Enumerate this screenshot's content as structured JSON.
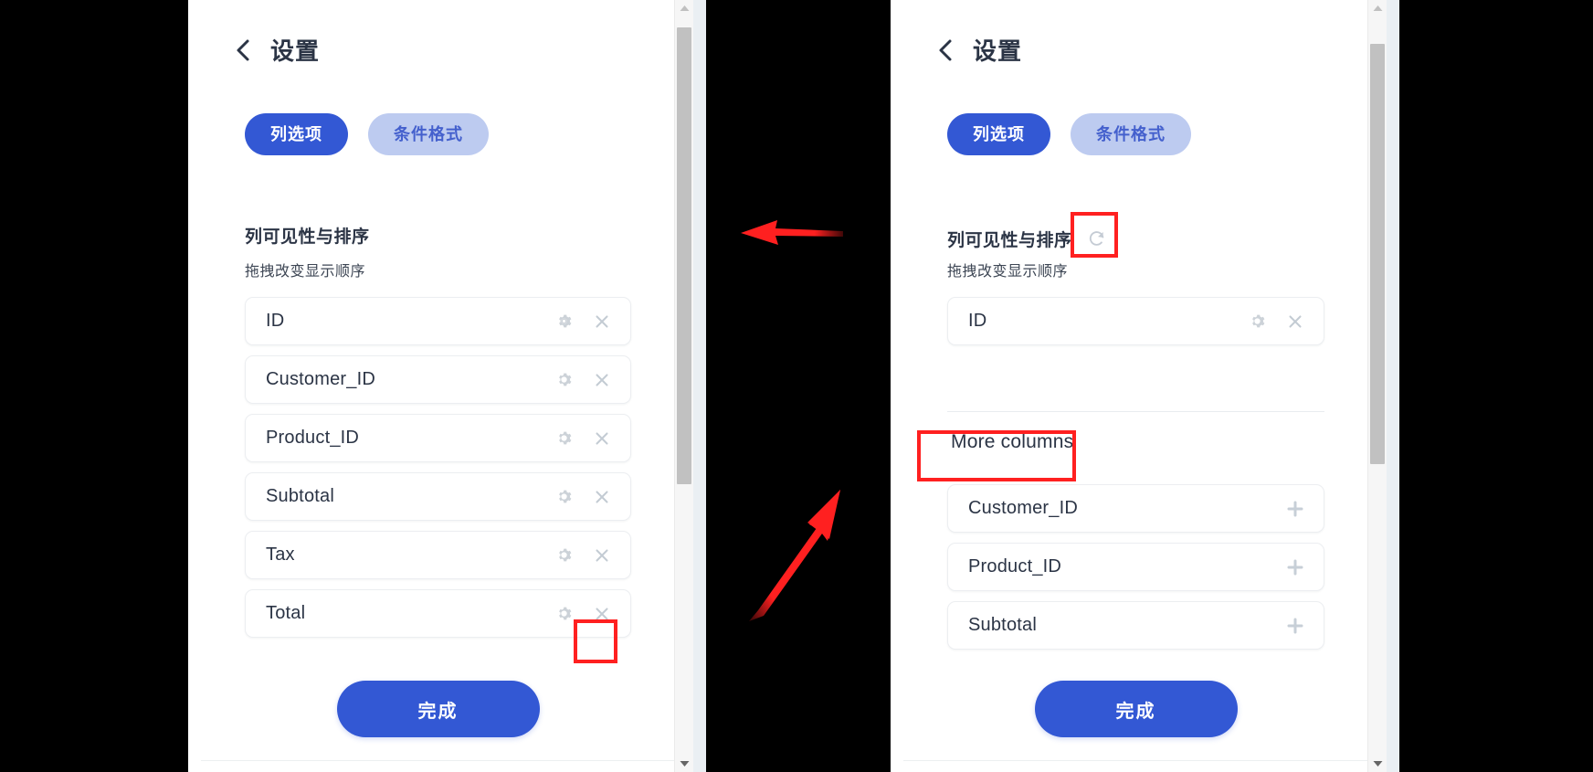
{
  "colors": {
    "accent": "#3358d4",
    "tab_idle_bg": "#bdcbf0",
    "tab_idle_text": "#4460cd",
    "annotation_red": "#ff2020",
    "row_border": "#eceef1",
    "icon_gray": "#c7cfd7",
    "panel_bg": "#ffffff",
    "backdrop": "#000000",
    "page_edge": "#eaeff3"
  },
  "left_panel": {
    "header": {
      "back_icon": "chevron-left-icon",
      "title": "设置"
    },
    "tabs": [
      {
        "label": "列选项",
        "active": true
      },
      {
        "label": "条件格式",
        "active": false
      }
    ],
    "section": {
      "title": "列可见性与排序",
      "subtitle": "拖拽改变显示顺序",
      "has_refresh": false
    },
    "columns": [
      {
        "label": "ID",
        "gear_icon": "gear-icon",
        "remove_icon": "close-icon",
        "highlighted": false
      },
      {
        "label": "Customer_ID",
        "gear_icon": "gear-icon",
        "remove_icon": "close-icon",
        "highlighted": false
      },
      {
        "label": "Product_ID",
        "gear_icon": "gear-icon",
        "remove_icon": "close-icon",
        "highlighted": false
      },
      {
        "label": "Subtotal",
        "gear_icon": "gear-icon",
        "remove_icon": "close-icon",
        "highlighted": false
      },
      {
        "label": "Tax",
        "gear_icon": "gear-icon",
        "remove_icon": "close-icon",
        "highlighted": false
      },
      {
        "label": "Total",
        "gear_icon": "gear-icon",
        "remove_icon": "close-icon",
        "highlighted": true
      }
    ],
    "done_button": "完成",
    "scrollbar": {
      "up_icon": "scroll-up-arrow-icon",
      "down_icon": "scroll-down-arrow-icon",
      "thumb_top_pct": 4,
      "thumb_height_pct": 63
    }
  },
  "right_panel": {
    "header": {
      "back_icon": "chevron-left-icon",
      "title": "设置"
    },
    "tabs": [
      {
        "label": "列选项",
        "active": true
      },
      {
        "label": "条件格式",
        "active": false
      }
    ],
    "section": {
      "title": "列可见性与排序",
      "subtitle": "拖拽改变显示顺序",
      "has_refresh": true,
      "refresh_icon": "refresh-icon"
    },
    "columns": [
      {
        "label": "ID",
        "gear_icon": "gear-icon",
        "remove_icon": "close-icon"
      }
    ],
    "more_columns": {
      "title": "More columns",
      "items": [
        {
          "label": "Customer_ID",
          "add_icon": "plus-icon"
        },
        {
          "label": "Product_ID",
          "add_icon": "plus-icon"
        },
        {
          "label": "Subtotal",
          "add_icon": "plus-icon"
        }
      ]
    },
    "done_button": "完成",
    "scrollbar": {
      "up_icon": "scroll-up-arrow-icon",
      "down_icon": "scroll-down-arrow-icon",
      "thumb_top_pct": 6,
      "thumb_height_pct": 58
    }
  },
  "annotations": {
    "arrow_left": {
      "direction": "left",
      "color": "#ff2020"
    },
    "arrow_up_right": {
      "direction": "up-right",
      "color": "#ff2020"
    },
    "boxes": [
      {
        "target": "left-total-remove-button"
      },
      {
        "target": "right-refresh-button"
      },
      {
        "target": "right-more-columns-title"
      }
    ]
  }
}
